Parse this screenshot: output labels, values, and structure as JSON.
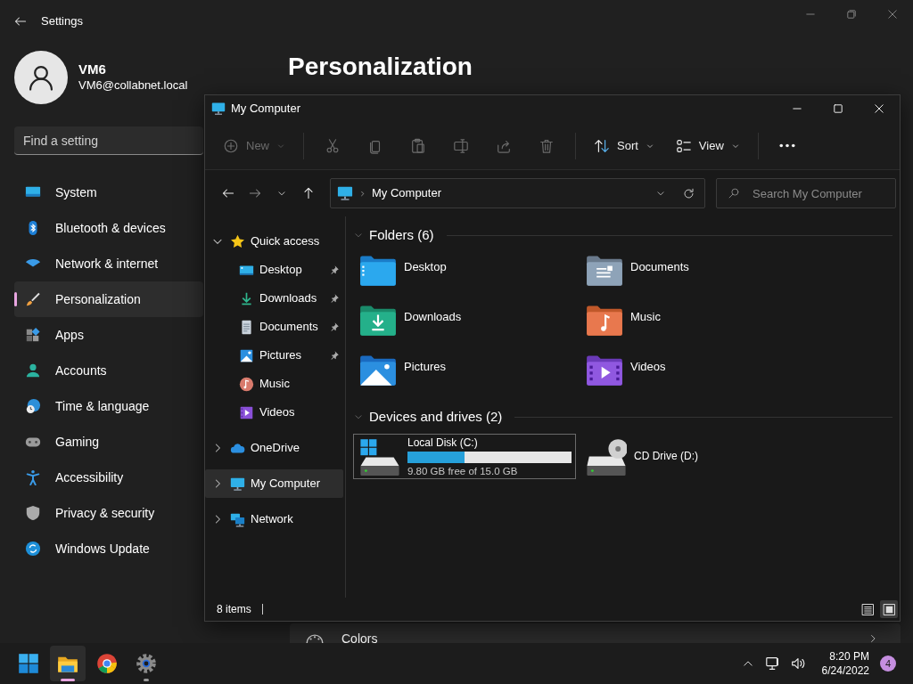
{
  "settings": {
    "title": "Settings",
    "user": {
      "name": "VM6",
      "email": "VM6@collabnet.local"
    },
    "search": {
      "placeholder": "Find a setting"
    },
    "nav": [
      {
        "label": "System",
        "selected": false
      },
      {
        "label": "Bluetooth & devices",
        "selected": false
      },
      {
        "label": "Network & internet",
        "selected": false
      },
      {
        "label": "Personalization",
        "selected": true
      },
      {
        "label": "Apps",
        "selected": false
      },
      {
        "label": "Accounts",
        "selected": false
      },
      {
        "label": "Time & language",
        "selected": false
      },
      {
        "label": "Gaming",
        "selected": false
      },
      {
        "label": "Accessibility",
        "selected": false
      },
      {
        "label": "Privacy & security",
        "selected": false
      },
      {
        "label": "Windows Update",
        "selected": false
      }
    ],
    "page_title": "Personalization",
    "rows": [
      {
        "label": "Colors"
      }
    ]
  },
  "explorer": {
    "title": "My Computer",
    "toolbar": [
      {
        "kind": "menu",
        "label": "New",
        "disabled": true
      },
      {
        "kind": "separator"
      },
      {
        "kind": "icon",
        "disabled": true
      },
      {
        "kind": "icon",
        "disabled": true
      },
      {
        "kind": "icon",
        "disabled": true
      },
      {
        "kind": "icon",
        "disabled": true
      },
      {
        "kind": "icon",
        "disabled": true
      },
      {
        "kind": "icon",
        "disabled": true
      },
      {
        "kind": "separator"
      },
      {
        "kind": "menu",
        "label": "Sort",
        "disabled": false
      },
      {
        "kind": "menu",
        "label": "View",
        "disabled": false
      },
      {
        "kind": "separator"
      },
      {
        "kind": "icon",
        "disabled": false
      }
    ],
    "nav_buttons": [
      {
        "disabled": false
      },
      {
        "disabled": true
      },
      {
        "disabled": false
      },
      {
        "disabled": false
      }
    ],
    "address": {
      "path": "My Computer"
    },
    "search": {
      "placeholder": "Search My Computer"
    },
    "tree": [
      {
        "label": "Quick access",
        "expanded": true,
        "selected": false,
        "children": [
          {
            "label": "Desktop",
            "pinned": true,
            "selected": false
          },
          {
            "label": "Downloads",
            "pinned": true,
            "selected": false
          },
          {
            "label": "Documents",
            "pinned": true,
            "selected": false
          },
          {
            "label": "Pictures",
            "pinned": true,
            "selected": false
          },
          {
            "label": "Music",
            "pinned": false,
            "selected": false
          },
          {
            "label": "Videos",
            "pinned": false,
            "selected": false
          }
        ]
      },
      {
        "label": "OneDrive",
        "expanded": false,
        "selected": false
      },
      {
        "label": "My Computer",
        "expanded": false,
        "selected": true
      },
      {
        "label": "Network",
        "expanded": false,
        "selected": false
      }
    ],
    "groups": [
      {
        "title": "Folders (6)",
        "expanded": true,
        "items": [
          {
            "kind": "folder",
            "label": "Desktop",
            "selected": false
          },
          {
            "kind": "folder",
            "label": "Documents",
            "selected": false
          },
          {
            "kind": "folder",
            "label": "Downloads",
            "selected": false
          },
          {
            "kind": "folder",
            "label": "Music",
            "selected": false
          },
          {
            "kind": "folder",
            "label": "Pictures",
            "selected": false
          },
          {
            "kind": "folder",
            "label": "Videos",
            "selected": false
          }
        ]
      },
      {
        "title": "Devices and drives (2)",
        "expanded": true,
        "items": [
          {
            "kind": "drive",
            "label": "Local Disk (C:)",
            "level": 0.35,
            "detail": "9.80 GB free of 15.0 GB",
            "selected": true
          },
          {
            "kind": "drive",
            "label": "CD Drive (D:)",
            "selected": false
          }
        ]
      }
    ],
    "status": {
      "text": "8 items",
      "views": [
        {
          "selected": false
        },
        {
          "selected": true
        }
      ]
    }
  },
  "taskbar": {
    "apps": [
      {
        "active": false,
        "running": false
      },
      {
        "active": true,
        "running": true
      },
      {
        "active": false,
        "running": false
      },
      {
        "active": false,
        "running": true
      }
    ],
    "time": "8:20 PM",
    "date": "6/24/2022",
    "badge": "4"
  }
}
